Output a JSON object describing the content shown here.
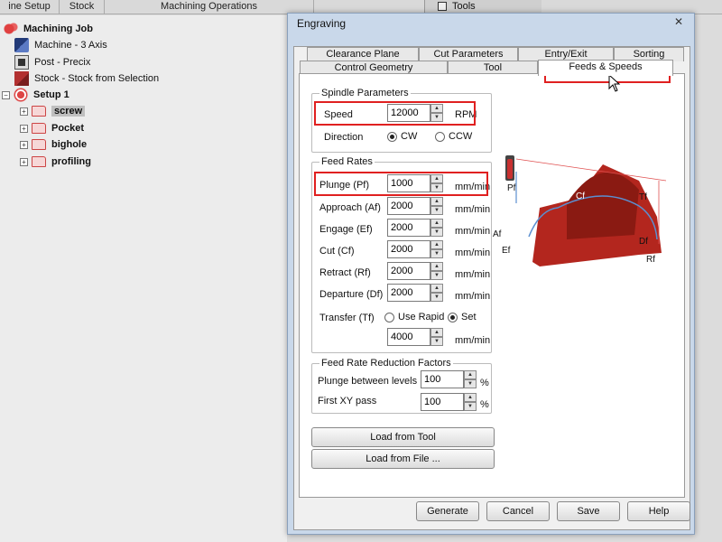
{
  "background": {
    "top_tabs": [
      "ine Setup",
      "Stock",
      "Machining Operations"
    ],
    "tools_label": "Tools",
    "tree": [
      {
        "label": "Machining Job",
        "icon": "machining-job-icon",
        "bold": true
      },
      {
        "label": "Machine - 3 Axis",
        "icon": "machine-icon"
      },
      {
        "label": "Post - Precix",
        "icon": "post-processor-icon"
      },
      {
        "label": "Stock - Stock from Selection",
        "icon": "stock-icon"
      },
      {
        "label": "Setup 1",
        "icon": "setup-icon",
        "bold": true
      },
      {
        "label": "screw",
        "icon": "folder-icon",
        "selected": true
      },
      {
        "label": "Pocket",
        "icon": "folder-icon"
      },
      {
        "label": "bighole",
        "icon": "folder-icon"
      },
      {
        "label": "profiling",
        "icon": "folder-icon"
      }
    ]
  },
  "dialog": {
    "title": "Engraving",
    "close": "✕",
    "tabs_row1": [
      "Clearance Plane",
      "Cut Parameters",
      "Entry/Exit",
      "Sorting"
    ],
    "tabs_row2": [
      "Control Geometry",
      "Tool",
      "Feeds & Speeds"
    ],
    "active_tab": "Feeds & Speeds",
    "spindle": {
      "legend": "Spindle Parameters",
      "speed_label": "Speed",
      "speed_value": "12000",
      "speed_unit": "RPM",
      "direction_label": "Direction",
      "cw_label": "CW",
      "ccw_label": "CCW",
      "direction": "CW"
    },
    "feed_rates": {
      "legend": "Feed Rates",
      "rows": [
        {
          "label": "Plunge (Pf)",
          "value": "1000",
          "unit": "mm/min"
        },
        {
          "label": "Approach (Af)",
          "value": "2000",
          "unit": "mm/min"
        },
        {
          "label": "Engage (Ef)",
          "value": "2000",
          "unit": "mm/min"
        },
        {
          "label": "Cut (Cf)",
          "value": "2000",
          "unit": "mm/min"
        },
        {
          "label": "Retract (Rf)",
          "value": "2000",
          "unit": "mm/min"
        },
        {
          "label": "Departure  (Df)",
          "value": "2000",
          "unit": "mm/min"
        }
      ],
      "transfer_label": "Transfer (Tf)",
      "use_rapid_label": "Use Rapid",
      "set_label": "Set",
      "transfer_mode": "Set",
      "transfer_value": "4000",
      "transfer_unit": "mm/min"
    },
    "reduction": {
      "legend": "Feed Rate Reduction Factors",
      "plunge_label": "Plunge between levels",
      "plunge_value": "100",
      "first_label": "First XY pass",
      "first_value": "100",
      "unit": "%"
    },
    "load_tool": "Load from Tool",
    "load_file": "Load from File ...",
    "buttons": {
      "generate": "Generate",
      "cancel": "Cancel",
      "save": "Save",
      "help": "Help"
    },
    "diagram_labels": {
      "pf": "Pf",
      "cf": "Cf",
      "tf": "Tf",
      "af": "Af",
      "ef": "Ef",
      "df": "Df",
      "rf": "Rf"
    },
    "colors": {
      "highlight": "#e02020",
      "stock": "#b3261e",
      "toolpath": "#5b8fd0"
    }
  }
}
